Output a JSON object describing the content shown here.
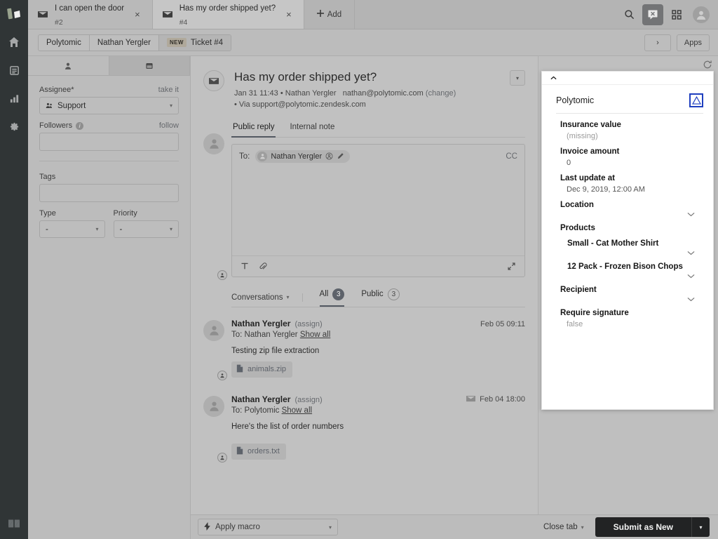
{
  "nav": {
    "brand_logo": "polytomic-logo",
    "items": [
      {
        "name": "home",
        "icon": "home-icon"
      },
      {
        "name": "views",
        "icon": "views-icon"
      },
      {
        "name": "reporting",
        "icon": "bar-chart-icon"
      },
      {
        "name": "admin",
        "icon": "gear-icon"
      }
    ],
    "footer_logo": "zendesk-logo"
  },
  "topbar": {
    "tabs": [
      {
        "title": "I can open the door",
        "number": "#2",
        "icon": "mail-icon",
        "close": "×",
        "active": false
      },
      {
        "title": "Has my order shipped yet?",
        "number": "#4",
        "icon": "mail-icon",
        "close": "×",
        "active": true
      }
    ],
    "add_label": "Add",
    "add_icon": "plus-icon",
    "actions": [
      {
        "name": "search-icon",
        "label": "Search"
      },
      {
        "name": "chat-icon",
        "label": "Chat"
      },
      {
        "name": "apps-grid-icon",
        "label": "Products"
      },
      {
        "name": "user-avatar-icon",
        "label": "Profile"
      }
    ]
  },
  "breadcrumb": {
    "items": [
      {
        "label": "Polytomic",
        "badge": null
      },
      {
        "label": "Nathan Yergler",
        "badge": null
      },
      {
        "label": "Ticket #4",
        "badge": "NEW"
      }
    ],
    "next_icon": "›",
    "apps_label": "Apps"
  },
  "properties": {
    "tabs": [
      {
        "name": "user-tab",
        "icon": "person-icon",
        "active": false
      },
      {
        "name": "ticket-tab",
        "icon": "ticket-icon",
        "active": true
      }
    ],
    "assignee": {
      "label": "Assignee*",
      "action": "take it",
      "value": "Support",
      "icon": "group-icon"
    },
    "followers": {
      "label": "Followers",
      "action": "follow",
      "value": "",
      "info_icon": "info-icon"
    },
    "tags": {
      "label": "Tags",
      "value": ""
    },
    "type": {
      "label": "Type",
      "value": "-"
    },
    "priority": {
      "label": "Priority",
      "value": "-"
    }
  },
  "ticket": {
    "icon": "mail-icon",
    "title": "Has my order shipped yet?",
    "meta_date": "Jan 31 11:43",
    "meta_sep": "•",
    "meta_author": "Nathan Yergler",
    "meta_email": "nathan@polytomic.com",
    "meta_change": "(change)",
    "meta_via": "• Via support@polytomic.zendesk.com",
    "collapse_icon": "chevron-down-icon"
  },
  "composer": {
    "tabs": [
      {
        "label": "Public reply",
        "active": true
      },
      {
        "label": "Internal note",
        "active": false
      }
    ],
    "to_label": "To:",
    "recipient": "Nathan Yergler",
    "recipient_icon": "user-circle-icon",
    "edit_icon": "pencil-icon",
    "cc_label": "CC",
    "body_value": "",
    "body_placeholder": "",
    "tools": [
      {
        "name": "text-format-icon",
        "glyph": "T"
      },
      {
        "name": "attachment-icon",
        "glyph": "paperclip"
      }
    ],
    "expand_icon": "expand-icon"
  },
  "conversations": {
    "selector_label": "Conversations",
    "selector_icon": "chevron-down-icon",
    "filters": [
      {
        "label": "All",
        "count": "3",
        "active": true
      },
      {
        "label": "Public",
        "count": "3",
        "active": false
      }
    ],
    "messages": [
      {
        "author": "Nathan Yergler",
        "assign": "(assign)",
        "to_prefix": "To: Nathan Yergler",
        "show_all": "Show all",
        "timestamp": "Feb 05 09:11",
        "channel_icon": null,
        "body": "Testing zip file extraction",
        "attachment": "animals.zip",
        "attachment_icon": "file-icon"
      },
      {
        "author": "Nathan Yergler",
        "assign": "(assign)",
        "to_prefix": "To: Polytomic",
        "show_all": "Show all",
        "timestamp": "Feb 04 18:00",
        "channel_icon": "mail-icon",
        "body": "Here's the list of order numbers",
        "attachment": "orders.txt",
        "attachment_icon": "file-icon"
      }
    ]
  },
  "footer": {
    "macro_label": "Apply macro",
    "macro_icon": "lightning-icon",
    "macro_caret": "chevron-down-icon",
    "close_tab_label": "Close tab",
    "submit_label": "Submit as New",
    "submit_caret": "chevron-down-icon"
  },
  "app_panel": {
    "refresh_icon": "refresh-icon",
    "collapse_icon": "chevron-up-icon",
    "title": "Polytomic",
    "logo": "polytomic-triangle-logo",
    "fields": [
      {
        "key": "Insurance value",
        "value": "(missing)",
        "muted": true,
        "chevron": false,
        "nested": false
      },
      {
        "key": "Invoice amount",
        "value": "0",
        "muted": false,
        "chevron": false,
        "nested": false
      },
      {
        "key": "Last update at",
        "value": "Dec 9, 2019, 12:00 AM",
        "muted": false,
        "chevron": false,
        "nested": false
      },
      {
        "key": "Location",
        "value": null,
        "muted": false,
        "chevron": true,
        "nested": false
      },
      {
        "key": "Products",
        "value": null,
        "muted": false,
        "chevron": false,
        "nested": false
      },
      {
        "key": "Small - Cat Mother Shirt",
        "value": null,
        "muted": false,
        "chevron": true,
        "nested": true
      },
      {
        "key": "12 Pack - Frozen Bison Chops",
        "value": null,
        "muted": false,
        "chevron": true,
        "nested": true
      },
      {
        "key": "Recipient",
        "value": null,
        "muted": false,
        "chevron": true,
        "nested": false
      },
      {
        "key": "Require signature",
        "value": "false",
        "muted": true,
        "chevron": false,
        "nested": false
      }
    ]
  },
  "colors": {
    "nav_bg": "#1b3b3c",
    "accent_blue": "#3b5a8c",
    "link_blue": "#5a6a84",
    "badge_new": "#cfa65b",
    "submit_bg": "#1f232b",
    "panel_bg": "#ffffff",
    "logo_blue": "#1f3fbf"
  }
}
